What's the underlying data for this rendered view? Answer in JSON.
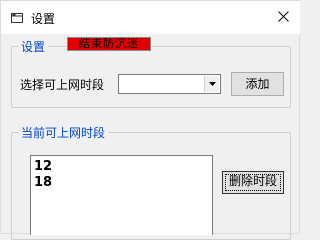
{
  "window": {
    "title": "设置",
    "close_label": "X"
  },
  "settings_group": {
    "title": "设置",
    "red_button_label": "结束防沉迷",
    "select_label": "选择可上网时段",
    "combo_value": "",
    "add_button": "添加"
  },
  "current_group": {
    "title": "当前可上网时段",
    "items": [
      "12",
      "18"
    ],
    "delete_button": "删除时段"
  },
  "colors": {
    "group_title": "#0046d5",
    "red_button": "#e00000"
  },
  "icons": {
    "app": "window-icon",
    "close": "close-icon",
    "dropdown": "chevron-down-icon"
  }
}
